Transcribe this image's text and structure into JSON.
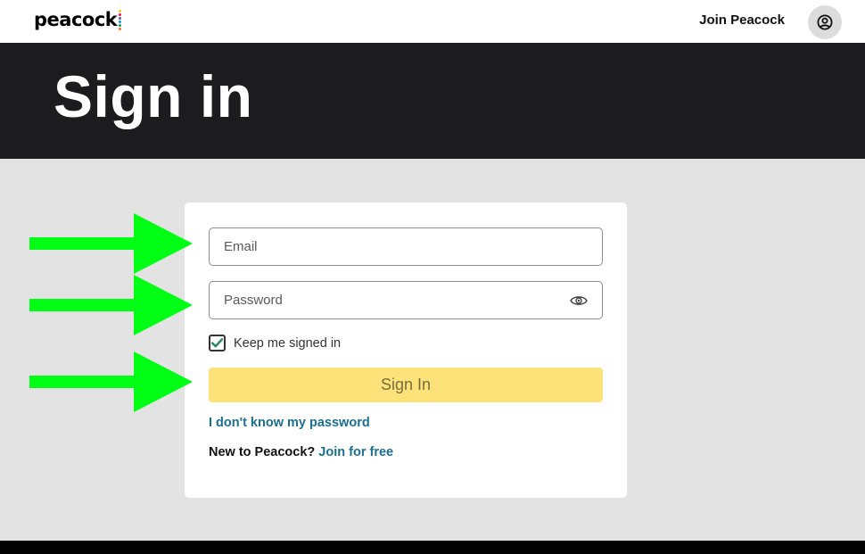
{
  "nav": {
    "logo_text": "peacock",
    "logo_dot_colors": [
      "#fccc12",
      "#ef1541",
      "#6d55a4",
      "#069de0",
      "#05ac3f",
      "#ff7112"
    ],
    "join_label": "Join Peacock",
    "account_icon": "user-circle-icon"
  },
  "hero": {
    "title": "Sign in"
  },
  "form": {
    "email_placeholder": "Email",
    "password_placeholder": "Password",
    "show_password_icon": "eye-icon",
    "keep_signed_in_label": "Keep me signed in",
    "keep_signed_in_checked": true,
    "sign_in_label": "Sign In",
    "forgot_label": "I don't know my password",
    "new_prompt": "New to Peacock?",
    "join_free_label": "Join for free"
  },
  "annotations": {
    "arrow_color": "#00ff14",
    "arrow_icon": "right-arrow-icon"
  },
  "colors": {
    "accent_yellow": "#fde27a",
    "link_blue": "#1a6f8f",
    "hero_bg": "#1c1c1e",
    "page_bg": "#e3e3e3"
  }
}
